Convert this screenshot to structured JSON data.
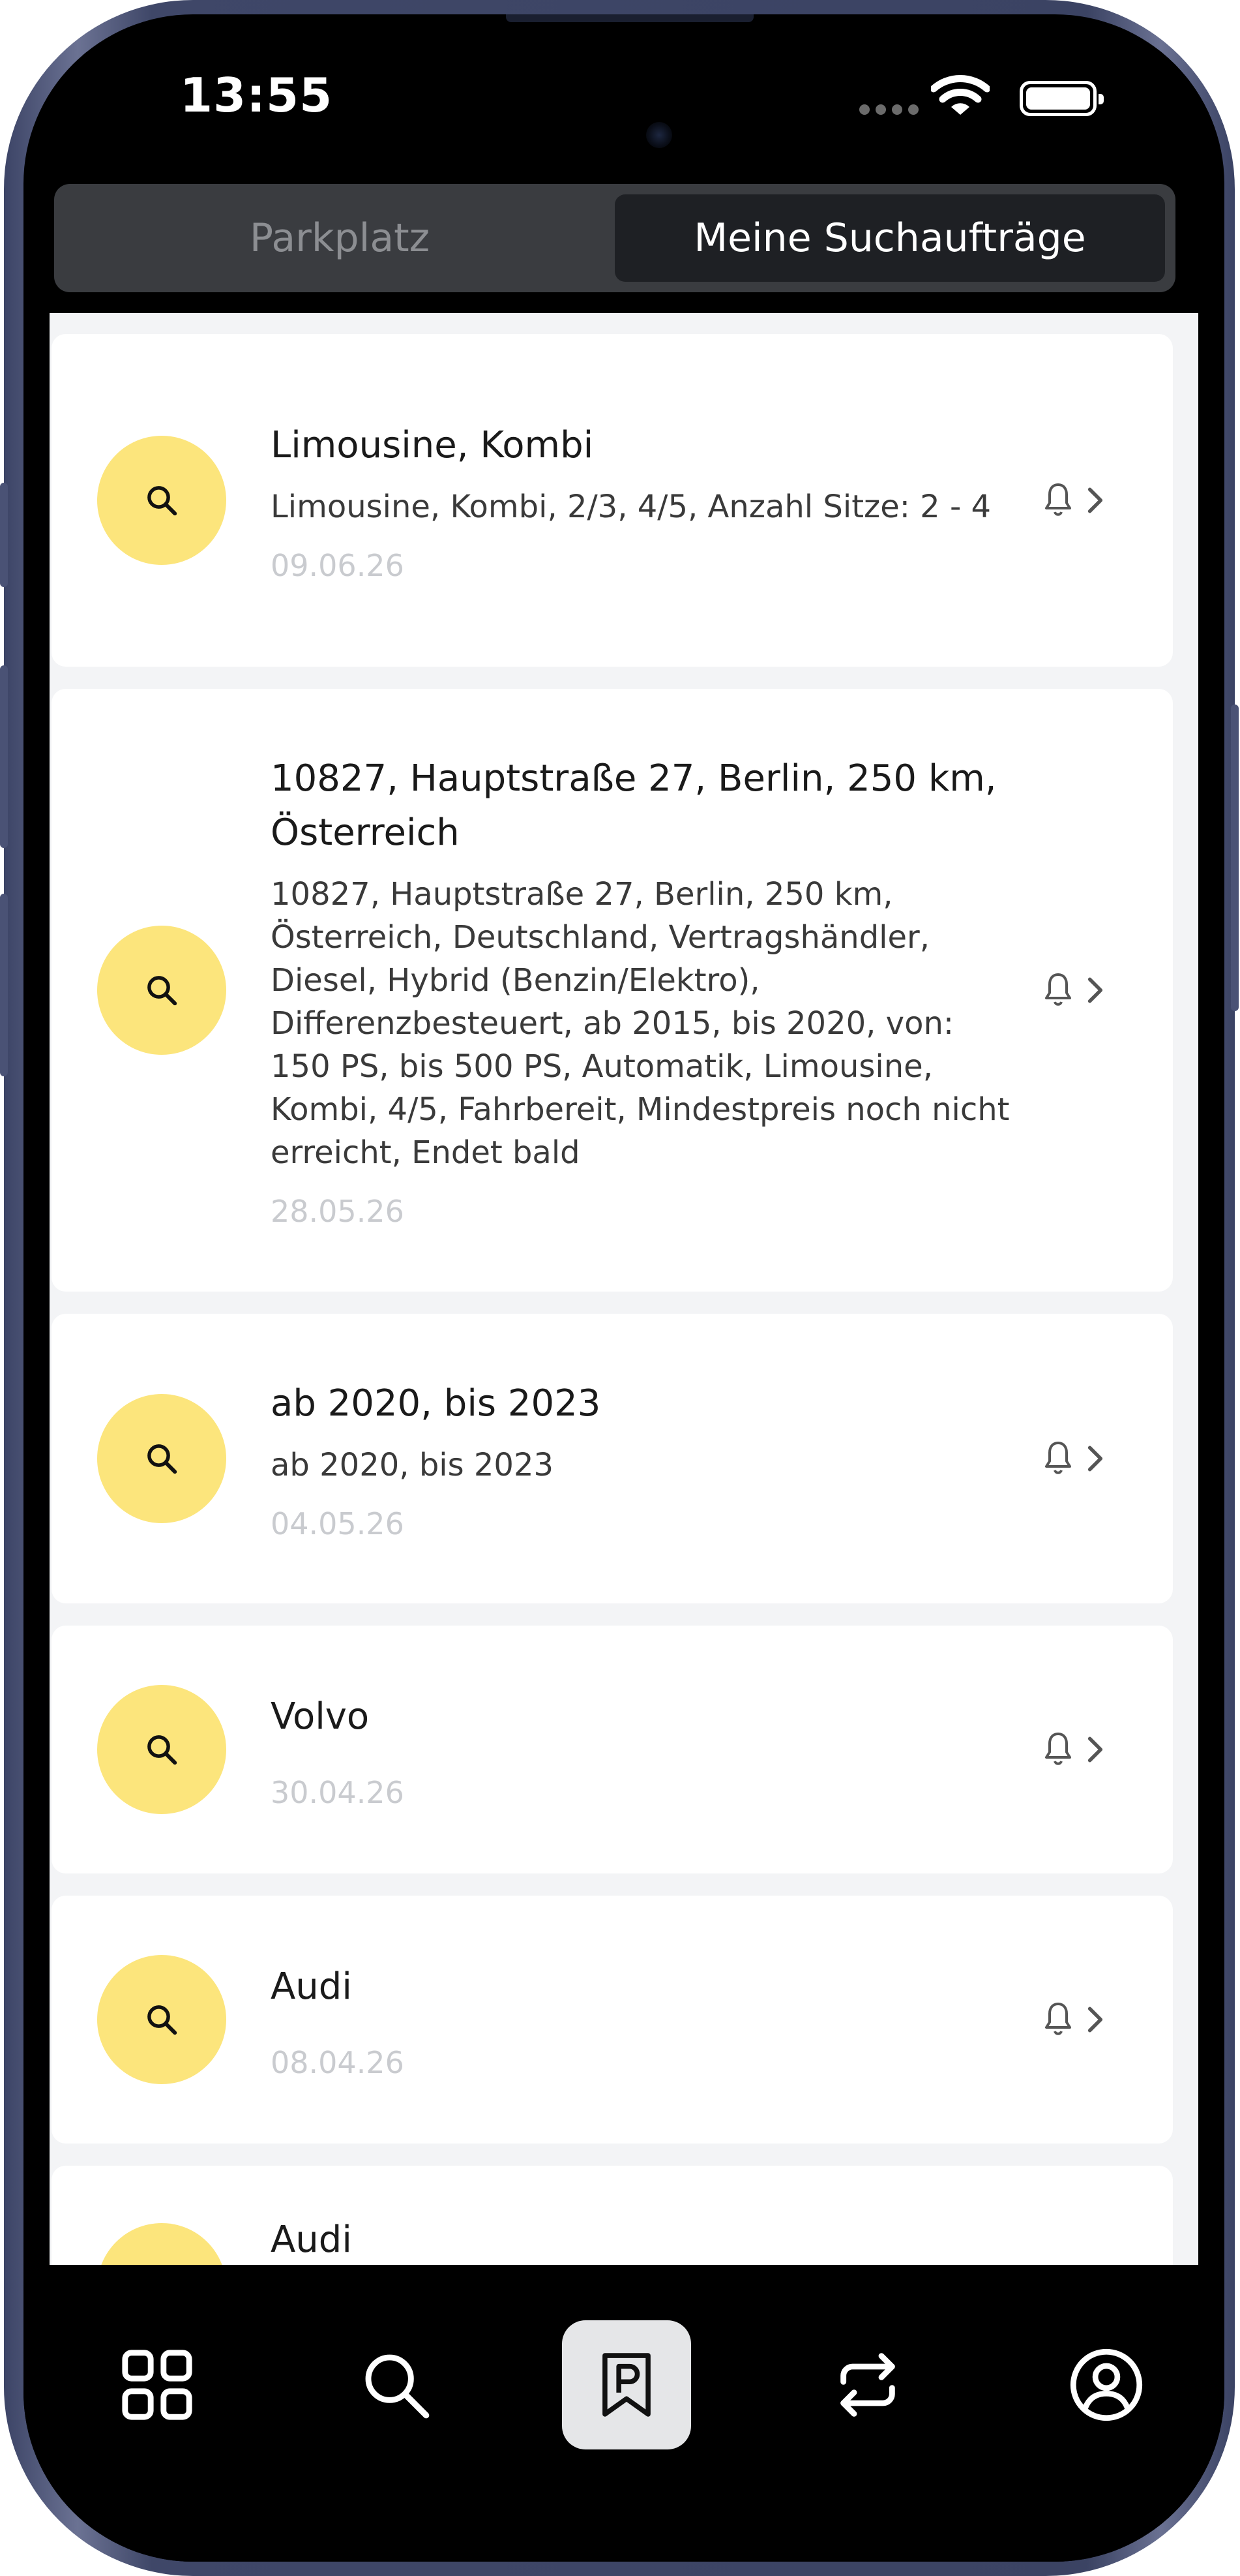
{
  "status_bar": {
    "time": "13:55"
  },
  "tabs": [
    {
      "label": "Parkplatz",
      "active": false
    },
    {
      "label": "Meine Suchaufträge",
      "active": true
    }
  ],
  "searches": [
    {
      "title": "Limousine, Kombi",
      "description": "Limousine, Kombi, 2/3, 4/5, Anzahl Sitze: 2 - 4",
      "date": "09.06.26"
    },
    {
      "title": "10827, Hauptstraße 27, Berlin, 250 km, Österreich",
      "description": "10827, Hauptstraße 27, Berlin, 250 km, Österreich, Deutschland, Vertragshändler, Diesel, Hybrid (Benzin/Elektro), Differenzbesteuert, ab 2015, bis 2020, von: 150 PS, bis 500 PS, Automatik, Limousine, Kombi, 4/5, Fahrbereit, Mindestpreis noch nicht erreicht, Endet bald",
      "date": "28.05.26"
    },
    {
      "title": "ab 2020, bis 2023",
      "description": "ab 2020, bis 2023",
      "date": "04.05.26"
    },
    {
      "title": "Volvo",
      "description": "",
      "date": "30.04.26"
    },
    {
      "title": "Audi",
      "description": "",
      "date": "08.04.26"
    },
    {
      "title": "Audi",
      "description": "",
      "date": ""
    }
  ],
  "bottom_nav": [
    {
      "icon": "dashboard-grid-icon",
      "active": false
    },
    {
      "icon": "search-icon",
      "active": false
    },
    {
      "icon": "parking-bookmark-icon",
      "active": true
    },
    {
      "icon": "repeat-arrows-icon",
      "active": false
    },
    {
      "icon": "user-profile-icon",
      "active": false
    }
  ],
  "colors": {
    "accent_yellow": "#fce57c",
    "tab_active_bg": "#1e2024",
    "tab_bar_bg": "#3a3c40",
    "list_bg": "#f3f4f6"
  }
}
